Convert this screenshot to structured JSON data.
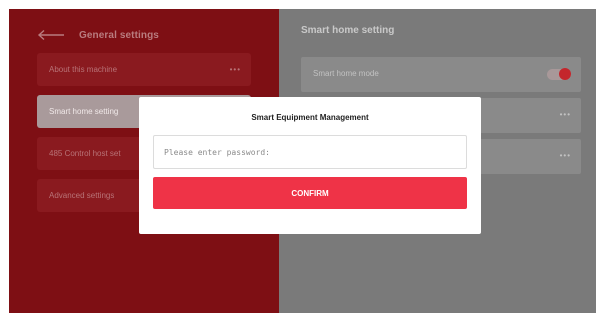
{
  "left_panel": {
    "title": "General settings",
    "items": [
      {
        "label": "About this machine",
        "dots": "•••"
      },
      {
        "label": "Smart home setting"
      },
      {
        "label": "485 Control host set"
      },
      {
        "label": "Advanced settings"
      }
    ]
  },
  "right_panel": {
    "title": "Smart home setting",
    "rows": [
      {
        "label": "Smart home mode",
        "toggle_on": true
      },
      {
        "label": "",
        "dots": "•••"
      },
      {
        "label": "",
        "dots": "•••"
      }
    ]
  },
  "modal": {
    "title": "Smart Equipment Management",
    "password_value": "",
    "password_placeholder": "Please enter password:",
    "confirm_label": "CONFIRM"
  },
  "colors": {
    "left_bg": "#7e0f14",
    "right_bg": "#7a7a7a",
    "accent": "#ef3347",
    "toggle_knob": "#c4262c"
  },
  "icons": {
    "back": "arrow-left-icon",
    "more": "more-dots-icon",
    "toggle": "toggle-switch"
  }
}
